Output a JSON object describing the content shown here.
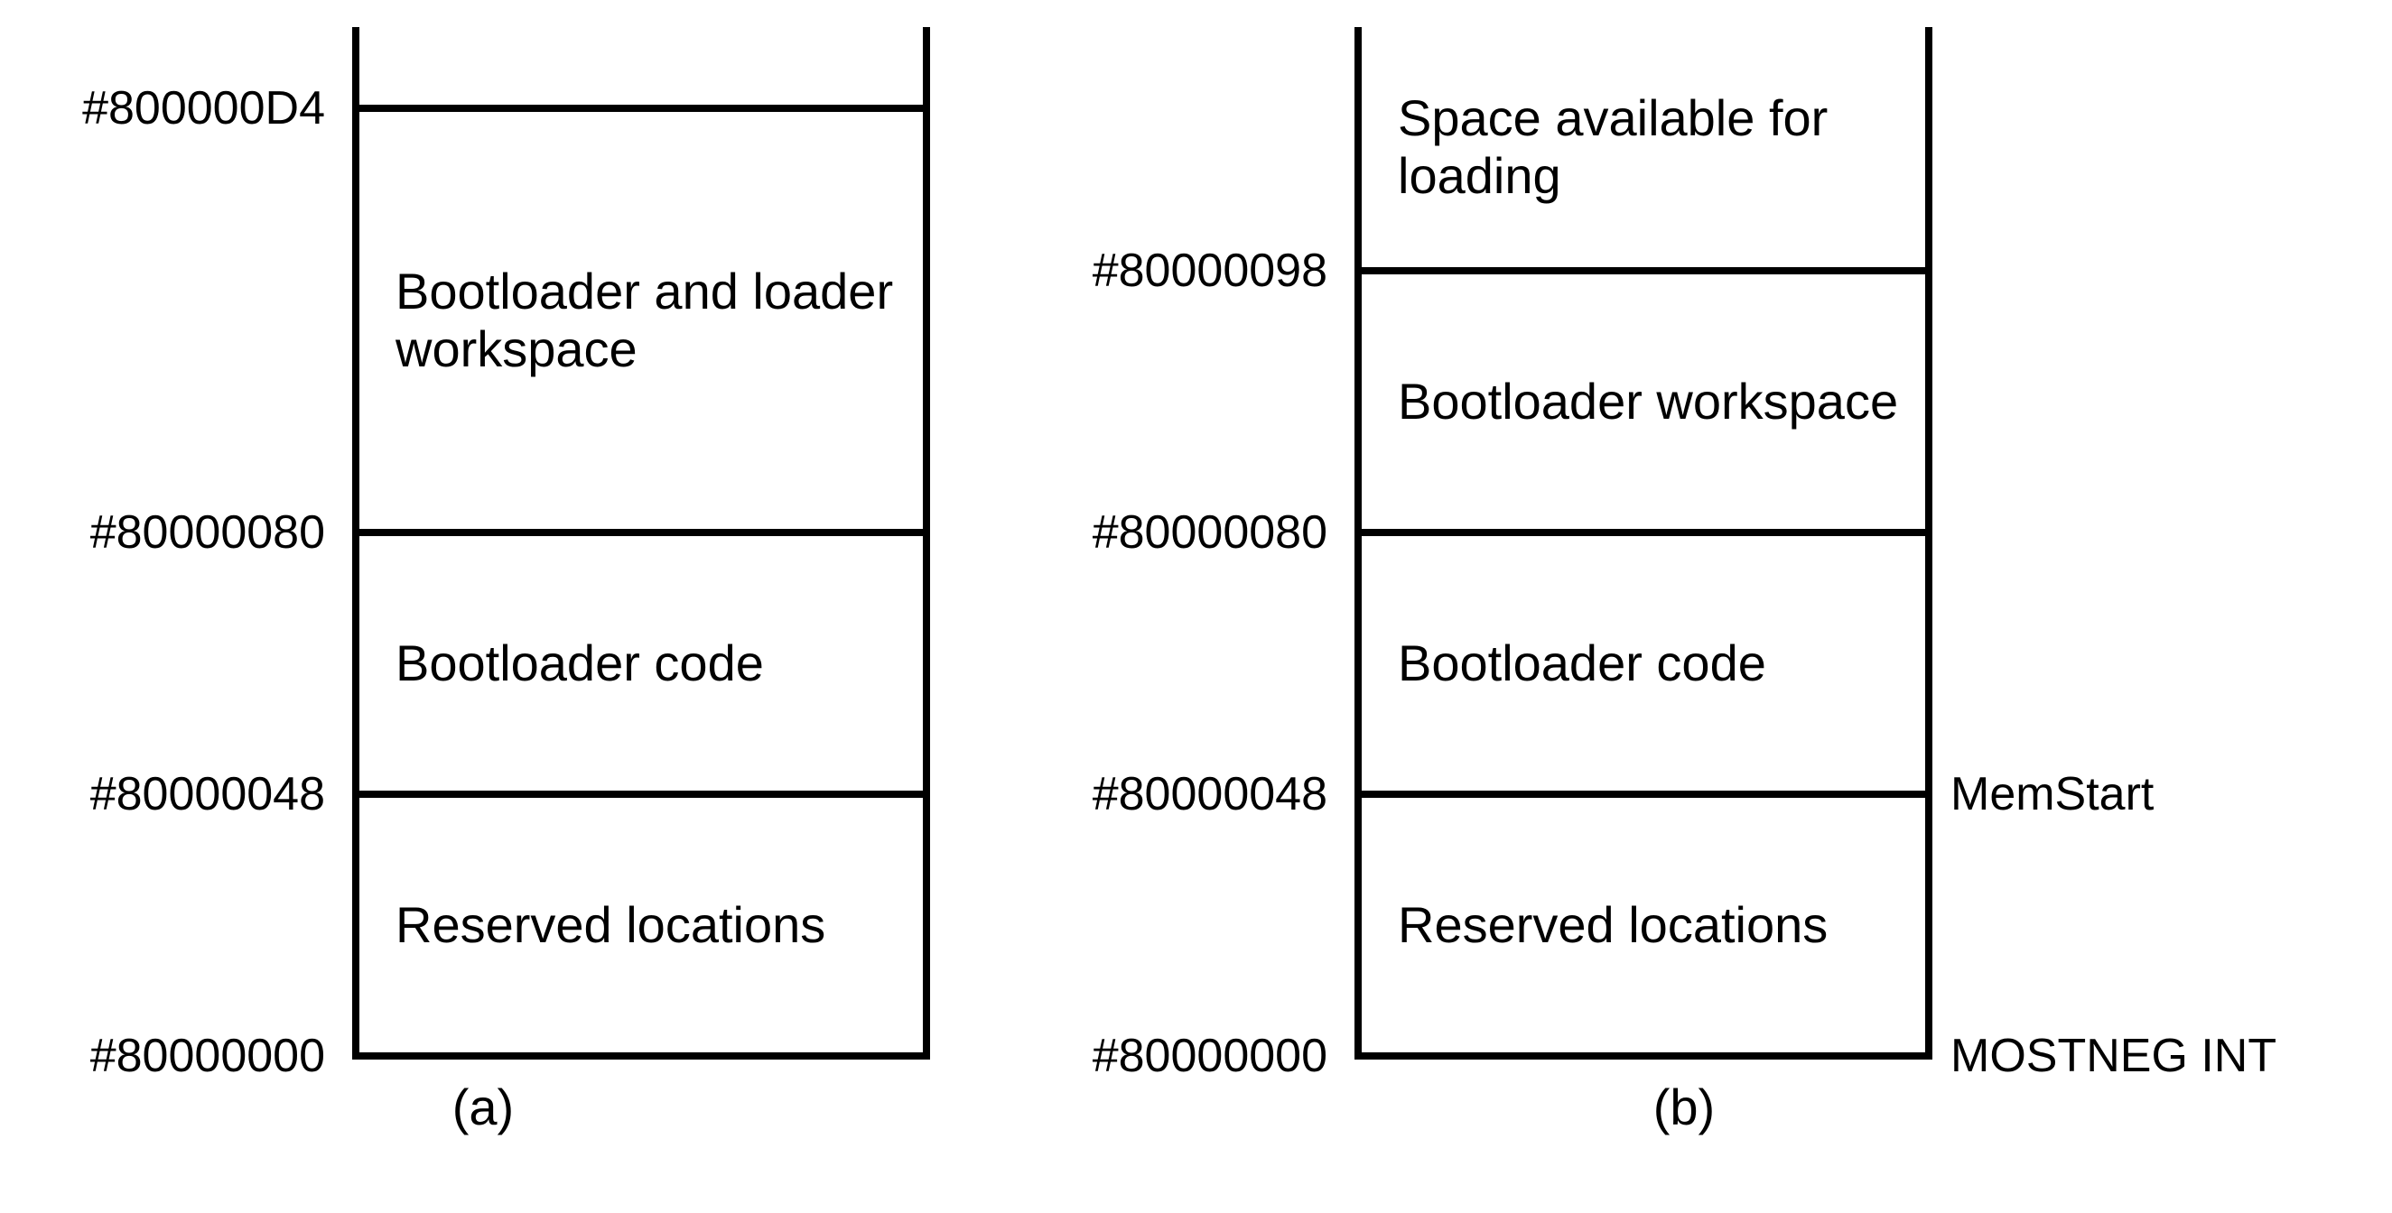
{
  "diagram_a": {
    "caption": "(a)",
    "addresses": {
      "a0": "#800000D4",
      "a1": "#80000080",
      "a2": "#80000048",
      "a3": "#80000000"
    },
    "segments": {
      "s0": "Bootloader and loader workspace",
      "s1": "Bootloader code",
      "s2": "Reserved locations"
    }
  },
  "diagram_b": {
    "caption": "(b)",
    "addresses": {
      "a0": "#80000098",
      "a1": "#80000080",
      "a2": "#80000048",
      "a3": "#80000000"
    },
    "segments": {
      "s_top": "Space available for loading",
      "s0": "Bootloader workspace",
      "s1": "Bootloader code",
      "s2": "Reserved locations"
    },
    "right_labels": {
      "r0": "MemStart",
      "r1": "MOSTNEG INT"
    }
  }
}
